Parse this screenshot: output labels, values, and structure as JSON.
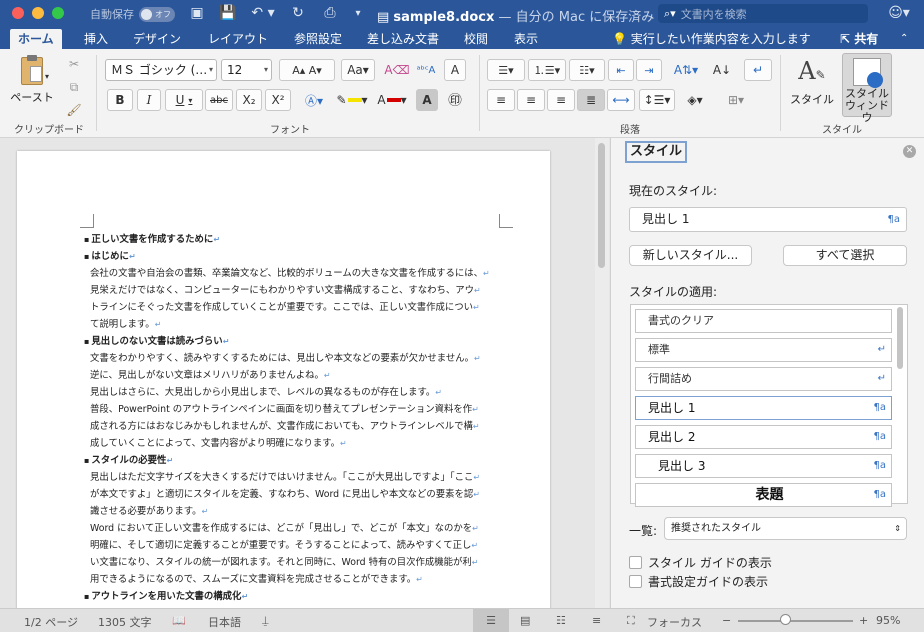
{
  "titlebar": {
    "autosave_label": "自動保存",
    "autosave_state": "オフ",
    "doc_name": "sample8.docx",
    "doc_suffix": " — 自分の Mac に保存済み",
    "search_placeholder": "文書内を検索"
  },
  "tabs": [
    "ホーム",
    "挿入",
    "デザイン",
    "レイアウト",
    "参照設定",
    "差し込み文書",
    "校閲",
    "表示"
  ],
  "tell_me": "実行したい作業内容を入力します",
  "share": "共有",
  "ribbon": {
    "paste_label": "ペースト",
    "clipboard_label": "クリップボード",
    "font_name": "ＭＳ ゴシック (…",
    "font_size": "12",
    "font_label": "フォント",
    "paragraph_label": "段落",
    "styles_label": "スタイル",
    "styles_btn": "スタイル",
    "style_window_line1": "スタイル",
    "style_window_line2": "ウィンドウ",
    "bold": "B",
    "italic": "I",
    "underline": "U",
    "strike": "abc"
  },
  "document": {
    "lines": [
      {
        "t": "正しい文書を作成するために",
        "h": true
      },
      {
        "t": "はじめに",
        "h": true
      },
      {
        "t": "会社の文書や自治会の書類、卒業論文など、比較的ボリュームの大きな文書を作成するには、",
        "h": false
      },
      {
        "t": "見栄えだけではなく、コンピューターにもわかりやすい文書構成すること、すなわち、アウ",
        "h": false
      },
      {
        "t": "トラインにそぐった文書を作成していくことが重要です。ここでは、正しい文書作成につい",
        "h": false
      },
      {
        "t": "て説明します。",
        "h": false
      },
      {
        "t": "見出しのない文書は読みづらい",
        "h": true
      },
      {
        "t": "文書をわかりやすく、読みやすくするためには、見出しや本文などの要素が欠かせません。",
        "h": false
      },
      {
        "t": "逆に、見出しがない文章はメリハリがありませんよね。",
        "h": false
      },
      {
        "t": "見出しはさらに、大見出しから小見出しまで、レベルの異なるものが存在します。",
        "h": false
      },
      {
        "t": "普段、PowerPoint のアウトラインペインに画面を切り替えてプレゼンテーション資料を作",
        "h": false
      },
      {
        "t": "成される方にはおなじみかもしれませんが、文書作成においても、アウトラインレベルで構",
        "h": false
      },
      {
        "t": "成していくことによって、文書内容がより明確になります。",
        "h": false
      },
      {
        "t": "スタイルの必要性",
        "h": true
      },
      {
        "t": "見出しはただ文字サイズを大きくするだけではいけません。「ここが大見出しですよ」「ここ",
        "h": false
      },
      {
        "t": "が本文ですよ」と適切にスタイルを定義、すなわち、Word に見出しや本文などの要素を認",
        "h": false
      },
      {
        "t": "識させる必要があります。",
        "h": false
      },
      {
        "t": "Word において正しい文書を作成するには、どこが「見出し」で、どこが「本文」なのかを",
        "h": false
      },
      {
        "t": "明確に、そして適切に定義することが重要です。そうすることによって、読みやすくて正し",
        "h": false
      },
      {
        "t": "い文書になり、スタイルの統一が図れます。それと同時に、Word 特有の目次作成機能が利",
        "h": false
      },
      {
        "t": "用できるようになるので、スムーズに文書資料を完成させることができます。",
        "h": false
      },
      {
        "t": "アウトラインを用いた文書の構成化",
        "h": true
      }
    ]
  },
  "pane": {
    "title": "スタイル",
    "current_label": "現在のスタイル:",
    "current_value": "見出し 1",
    "new_style": "新しいスタイル...",
    "select_all": "すべて選択",
    "apply_label": "スタイルの適用:",
    "styles": [
      {
        "name": "書式のクリア",
        "sym": ""
      },
      {
        "name": "標準",
        "sym": "↵"
      },
      {
        "name": "行間詰め",
        "sym": "↵"
      },
      {
        "name": "見出し 1",
        "sym": "¶a"
      },
      {
        "name": "見出し 2",
        "sym": "¶a"
      },
      {
        "name": "見出し 3",
        "sym": "¶a"
      },
      {
        "name": "表題",
        "sym": "¶a"
      }
    ],
    "list_label": "一覧:",
    "list_value": "推奨されたスタイル",
    "check1": "スタイル ガイドの表示",
    "check2": "書式設定ガイドの表示"
  },
  "status": {
    "page": "1/2 ページ",
    "words": "1305 文字",
    "lang": "日本語",
    "focus": "フォーカス",
    "zoom": "95%"
  },
  "colors": {
    "accent": "#2b579a",
    "highlight": "#f5e400",
    "font_color": "#d40000"
  }
}
